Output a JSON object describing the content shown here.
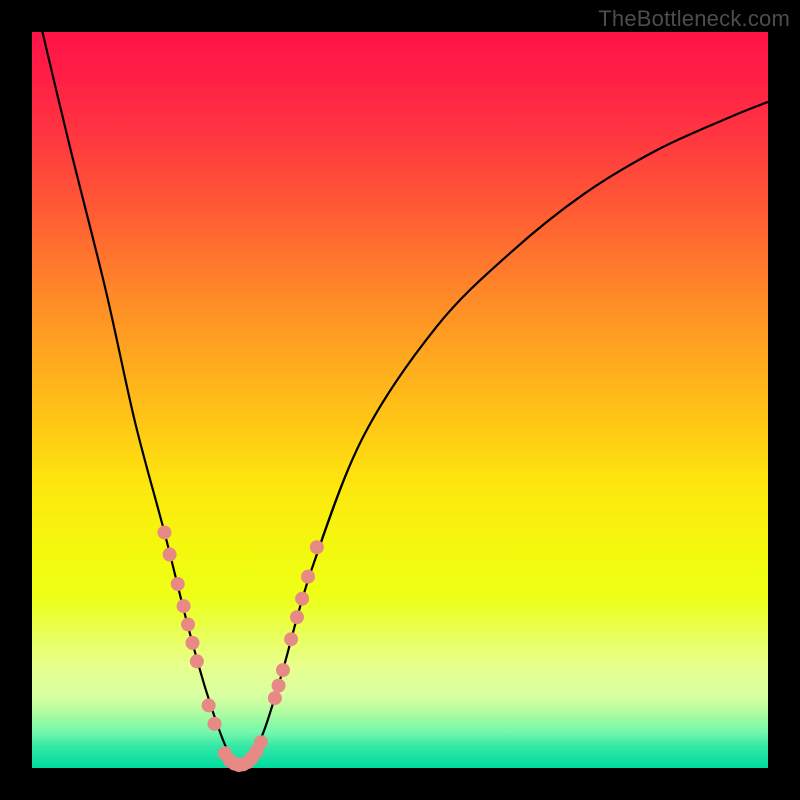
{
  "attribution": "TheBottleneck.com",
  "colors": {
    "frame": "#000000",
    "gradient_top": "#ff1448",
    "gradient_bottom": "#00db9f",
    "curve": "#000000",
    "dots": "#e78a86"
  },
  "chart_data": {
    "type": "line",
    "title": "",
    "xlabel": "",
    "ylabel": "",
    "xlim": [
      0,
      100
    ],
    "ylim": [
      0,
      100
    ],
    "series": [
      {
        "name": "bottleneck-curve",
        "x": [
          0,
          5,
          10,
          14,
          18,
          21,
          23.5,
          25.5,
          27,
          28,
          29.5,
          31.5,
          34,
          38,
          45,
          55,
          65,
          75,
          85,
          95,
          100
        ],
        "y": [
          106,
          85,
          65,
          47,
          32,
          20,
          11,
          5,
          1.5,
          0.4,
          1.2,
          5,
          13,
          27,
          45,
          60,
          70,
          78,
          84,
          88.5,
          90.5
        ]
      }
    ],
    "markers": [
      {
        "x": 18.0,
        "y": 32.0
      },
      {
        "x": 18.7,
        "y": 29.0
      },
      {
        "x": 19.8,
        "y": 25.0
      },
      {
        "x": 20.6,
        "y": 22.0
      },
      {
        "x": 21.2,
        "y": 19.5
      },
      {
        "x": 21.8,
        "y": 17.0
      },
      {
        "x": 22.4,
        "y": 14.5
      },
      {
        "x": 24.0,
        "y": 8.5
      },
      {
        "x": 24.8,
        "y": 6.0
      },
      {
        "x": 26.2,
        "y": 2.0
      },
      {
        "x": 26.9,
        "y": 1.0
      },
      {
        "x": 27.5,
        "y": 0.6
      },
      {
        "x": 28.1,
        "y": 0.4
      },
      {
        "x": 28.7,
        "y": 0.5
      },
      {
        "x": 29.3,
        "y": 0.8
      },
      {
        "x": 29.9,
        "y": 1.4
      },
      {
        "x": 30.5,
        "y": 2.3
      },
      {
        "x": 31.1,
        "y": 3.5
      },
      {
        "x": 33.0,
        "y": 9.5
      },
      {
        "x": 33.5,
        "y": 11.2
      },
      {
        "x": 34.1,
        "y": 13.3
      },
      {
        "x": 35.2,
        "y": 17.5
      },
      {
        "x": 36.0,
        "y": 20.5
      },
      {
        "x": 36.7,
        "y": 23.0
      },
      {
        "x": 37.5,
        "y": 26.0
      },
      {
        "x": 38.7,
        "y": 30.0
      }
    ],
    "marker_radius_px": 7
  }
}
